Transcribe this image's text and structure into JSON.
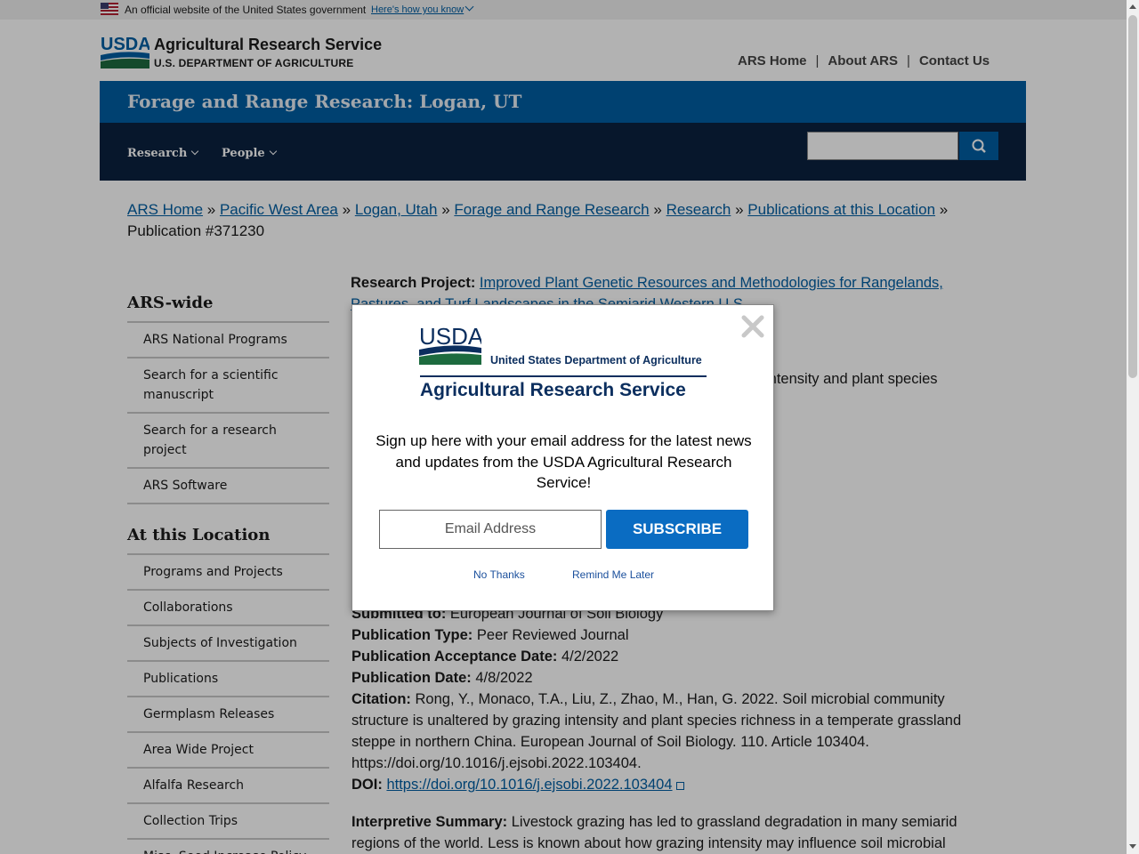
{
  "gov_banner": {
    "text": "An official website of the United States government",
    "link": "Here's how you know"
  },
  "header": {
    "logo_text": "USDA",
    "agency": "Agricultural Research Service",
    "department": "U.S. DEPARTMENT OF AGRICULTURE",
    "top_nav": [
      "ARS Home",
      "About ARS",
      "Contact Us"
    ],
    "site_title": "Forage and Range Research: Logan, UT",
    "nav": [
      "Research",
      "People"
    ],
    "search_value": ""
  },
  "breadcrumb": {
    "links": [
      "ARS Home",
      "Pacific West Area",
      "Logan, Utah",
      "Forage and Range Research",
      "Research",
      "Publications at this Location"
    ],
    "separator": "»",
    "current": "Publication #371230"
  },
  "sidebar": {
    "sections": [
      {
        "heading": "ARS-wide",
        "items": [
          "ARS National Programs",
          "Search for a scientific manuscript",
          "Search for a research project",
          "ARS Software"
        ]
      },
      {
        "heading": "At this Location",
        "items": [
          "Programs and Projects",
          "Collaborations",
          "Subjects of Investigation",
          "Publications",
          "Germplasm Releases",
          "Area Wide Project",
          "Alfalfa Research",
          "Collection Trips",
          "Misc. Seed Increase Policy"
        ]
      }
    ]
  },
  "publication": {
    "project_label": "Research Project:",
    "project_title": "Improved Plant Genetic Resources and Methodologies for Rangelands, Pastures, and Turf Landscapes in the Semiarid Western U.S.",
    "title_fragment": "intensity and plant species",
    "submitted_label": "Submitted to:",
    "submitted_value": "European Journal of Soil Biology",
    "type_label": "Publication Type:",
    "type_value": "Peer Reviewed Journal",
    "acceptance_label": "Publication Acceptance Date:",
    "acceptance_value": "4/2/2022",
    "date_label": "Publication Date:",
    "date_value": "4/8/2022",
    "citation_label": "Citation:",
    "citation_value": "Rong, Y., Monaco, T.A., Liu, Z., Zhao, M., Han, G. 2022. Soil microbial community structure is unaltered by grazing intensity and plant species richness in a temperate grassland steppe in northern China. European Journal of Soil Biology. 110. Article 103404. https://doi.org/10.1016/j.ejsobi.2022.103404.",
    "doi_label": "DOI:",
    "doi_value": "https://doi.org/10.1016/j.ejsobi.2022.103404",
    "summary_label": "Interpretive Summary:",
    "summary_value": "Livestock grazing has led to grassland degradation in many semiarid regions of the world. Less is known about how grazing intensity may influence soil microbial"
  },
  "modal": {
    "logo_text": "USDA",
    "department": "United States Department of Agriculture",
    "agency": "Agricultural Research Service",
    "message": "Sign up here with your email address for the latest news and updates from the USDA Agricultural Research Service!",
    "email_placeholder": "Email Address",
    "subscribe_label": "SUBSCRIBE",
    "no_thanks": "No Thanks",
    "remind_later": "Remind Me Later"
  },
  "colors": {
    "primary_blue": "#005ea2",
    "dark_navy": "#0b2240",
    "subscribe_blue": "#0a6cc2",
    "usda_green": "#1d6b3f"
  }
}
